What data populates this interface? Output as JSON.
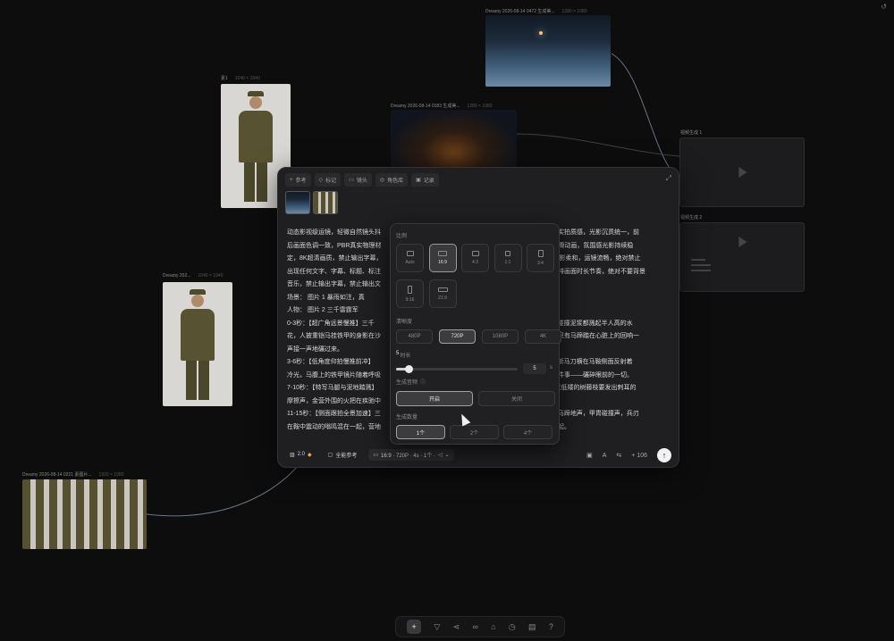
{
  "canvas": {
    "share_icon": "share-icon",
    "nodes": {
      "ice_video": {
        "caption": "Dreamy 2026-08-14 0472 生成美...",
        "size": "1280 × 1080"
      },
      "night_video": {
        "caption": "Dreamy 2026-08-14 0183 生成美...",
        "size": "1280 × 1080"
      },
      "soldier_1": {
        "caption": "素1",
        "size": "1040 × 1940"
      },
      "soldier_2": {
        "caption": "Dreamy 202...",
        "size": "1040 × 1940"
      },
      "group": {
        "caption": "Dreamy 2026-08-14 0221 素图片...",
        "size": "1920 × 1080"
      },
      "video_out_1": {
        "caption": "视频生成 1"
      },
      "video_out_2": {
        "caption": "视频生成 2"
      }
    }
  },
  "panel": {
    "tabs": [
      {
        "icon": "plus-icon",
        "label": "参考"
      },
      {
        "icon": "tag-icon",
        "label": "标记"
      },
      {
        "icon": "shot-icon",
        "label": "镜头"
      },
      {
        "icon": "palette-icon",
        "label": "角色库"
      },
      {
        "icon": "record-icon",
        "label": "记录"
      }
    ],
    "prompt_lines": [
      {
        "left": "动态影视级运镜，轻微自然镜头抖",
        "right": "真人实拍质感，光影沉贯统一，前"
      },
      {
        "left": "后画面色调一致，PBR真实物理材",
        "right": "事丝滑动画，氛围感光影持续稳"
      },
      {
        "left": "定，8K超清画质，禁止输出字幕，",
        "right": "，光影柔和，运镜流畅，绝对禁止"
      },
      {
        "left": "出现任何文字、字幕、标题、标注",
        "right": "理安排画面时长节奏，绝对不要背景"
      },
      {
        "left": "音乐，禁止输出字幕，禁止输出文",
        "right": ""
      },
      {
        "left": "场景：  图片 1  暴雨如注，真",
        "right": ""
      },
      {
        "left": "人物：  图片 2  三千雷霆军",
        "right": ""
      },
      {
        "left": "0-3秒：【超广角远景慢推】三千",
        "right": "每一次碰撞泥浆都溅起半人高的水"
      },
      {
        "left": "花，人披重铠马挂铁甲的身影在沙",
        "right": "埋，只有马蹄踏在心脏上的回响一"
      },
      {
        "left": "声接一声地碾过来。",
        "right": ""
      },
      {
        "left": "3-6秒：【低角度仰拍慢推前冲】",
        "right": "下滴，斩马刀横在马鞍侧面反射着"
      },
      {
        "left": "冷光，马腹上的铁甲镜片随着呼吸",
        "right": "有一件事——碾碎眼前的一切。"
      },
      {
        "left": "7-10秒：【特写马腿与泥地踏溅】",
        "right": "甲刮过低矮的树藤枝要发出刺耳的"
      },
      {
        "left": "摩擦声，金营外围的火把在疾驰中",
        "right": ""
      },
      {
        "left": "11-15秒：【侧面跟拍全景加速】三",
        "right": "后，马蹄地声，甲胄碰撞声，兵刃"
      },
      {
        "left": "在鞍中震动的嗡鸣混在一起，营地",
        "right": "搭拔起。"
      }
    ],
    "settings": {
      "ratio_label": "比例",
      "ratios": [
        "Auto",
        "16:9",
        "4:3",
        "1:1",
        "3:4",
        "9:16",
        "21:9"
      ],
      "ratio_selected": "16:9",
      "resolution_label": "清晰度",
      "resolutions": [
        "480P",
        "720P",
        "1080P",
        "4K"
      ],
      "resolution_selected": "720P",
      "duration_label": "时长",
      "duration_value": "5",
      "duration_knob_value": "5",
      "duration_unit": "s",
      "duration_fraction": 0.1,
      "audio_label": "生成音频",
      "audio_options": [
        "开启",
        "关闭"
      ],
      "audio_selected": "开启",
      "count_label": "生成数量",
      "counts": [
        "1个",
        "2个",
        "4个"
      ],
      "count_selected": "1个"
    },
    "bottom": {
      "model": "2.0",
      "reference": "全能参考",
      "summary": "16:9 · 720P · 4s · 1个 · ",
      "credits": "+ 106"
    }
  },
  "dock": {
    "icons": [
      "plus-icon",
      "select-icon",
      "share-node-icon",
      "link-icon",
      "upload-icon",
      "history-icon",
      "image-icon",
      "help-icon"
    ]
  }
}
